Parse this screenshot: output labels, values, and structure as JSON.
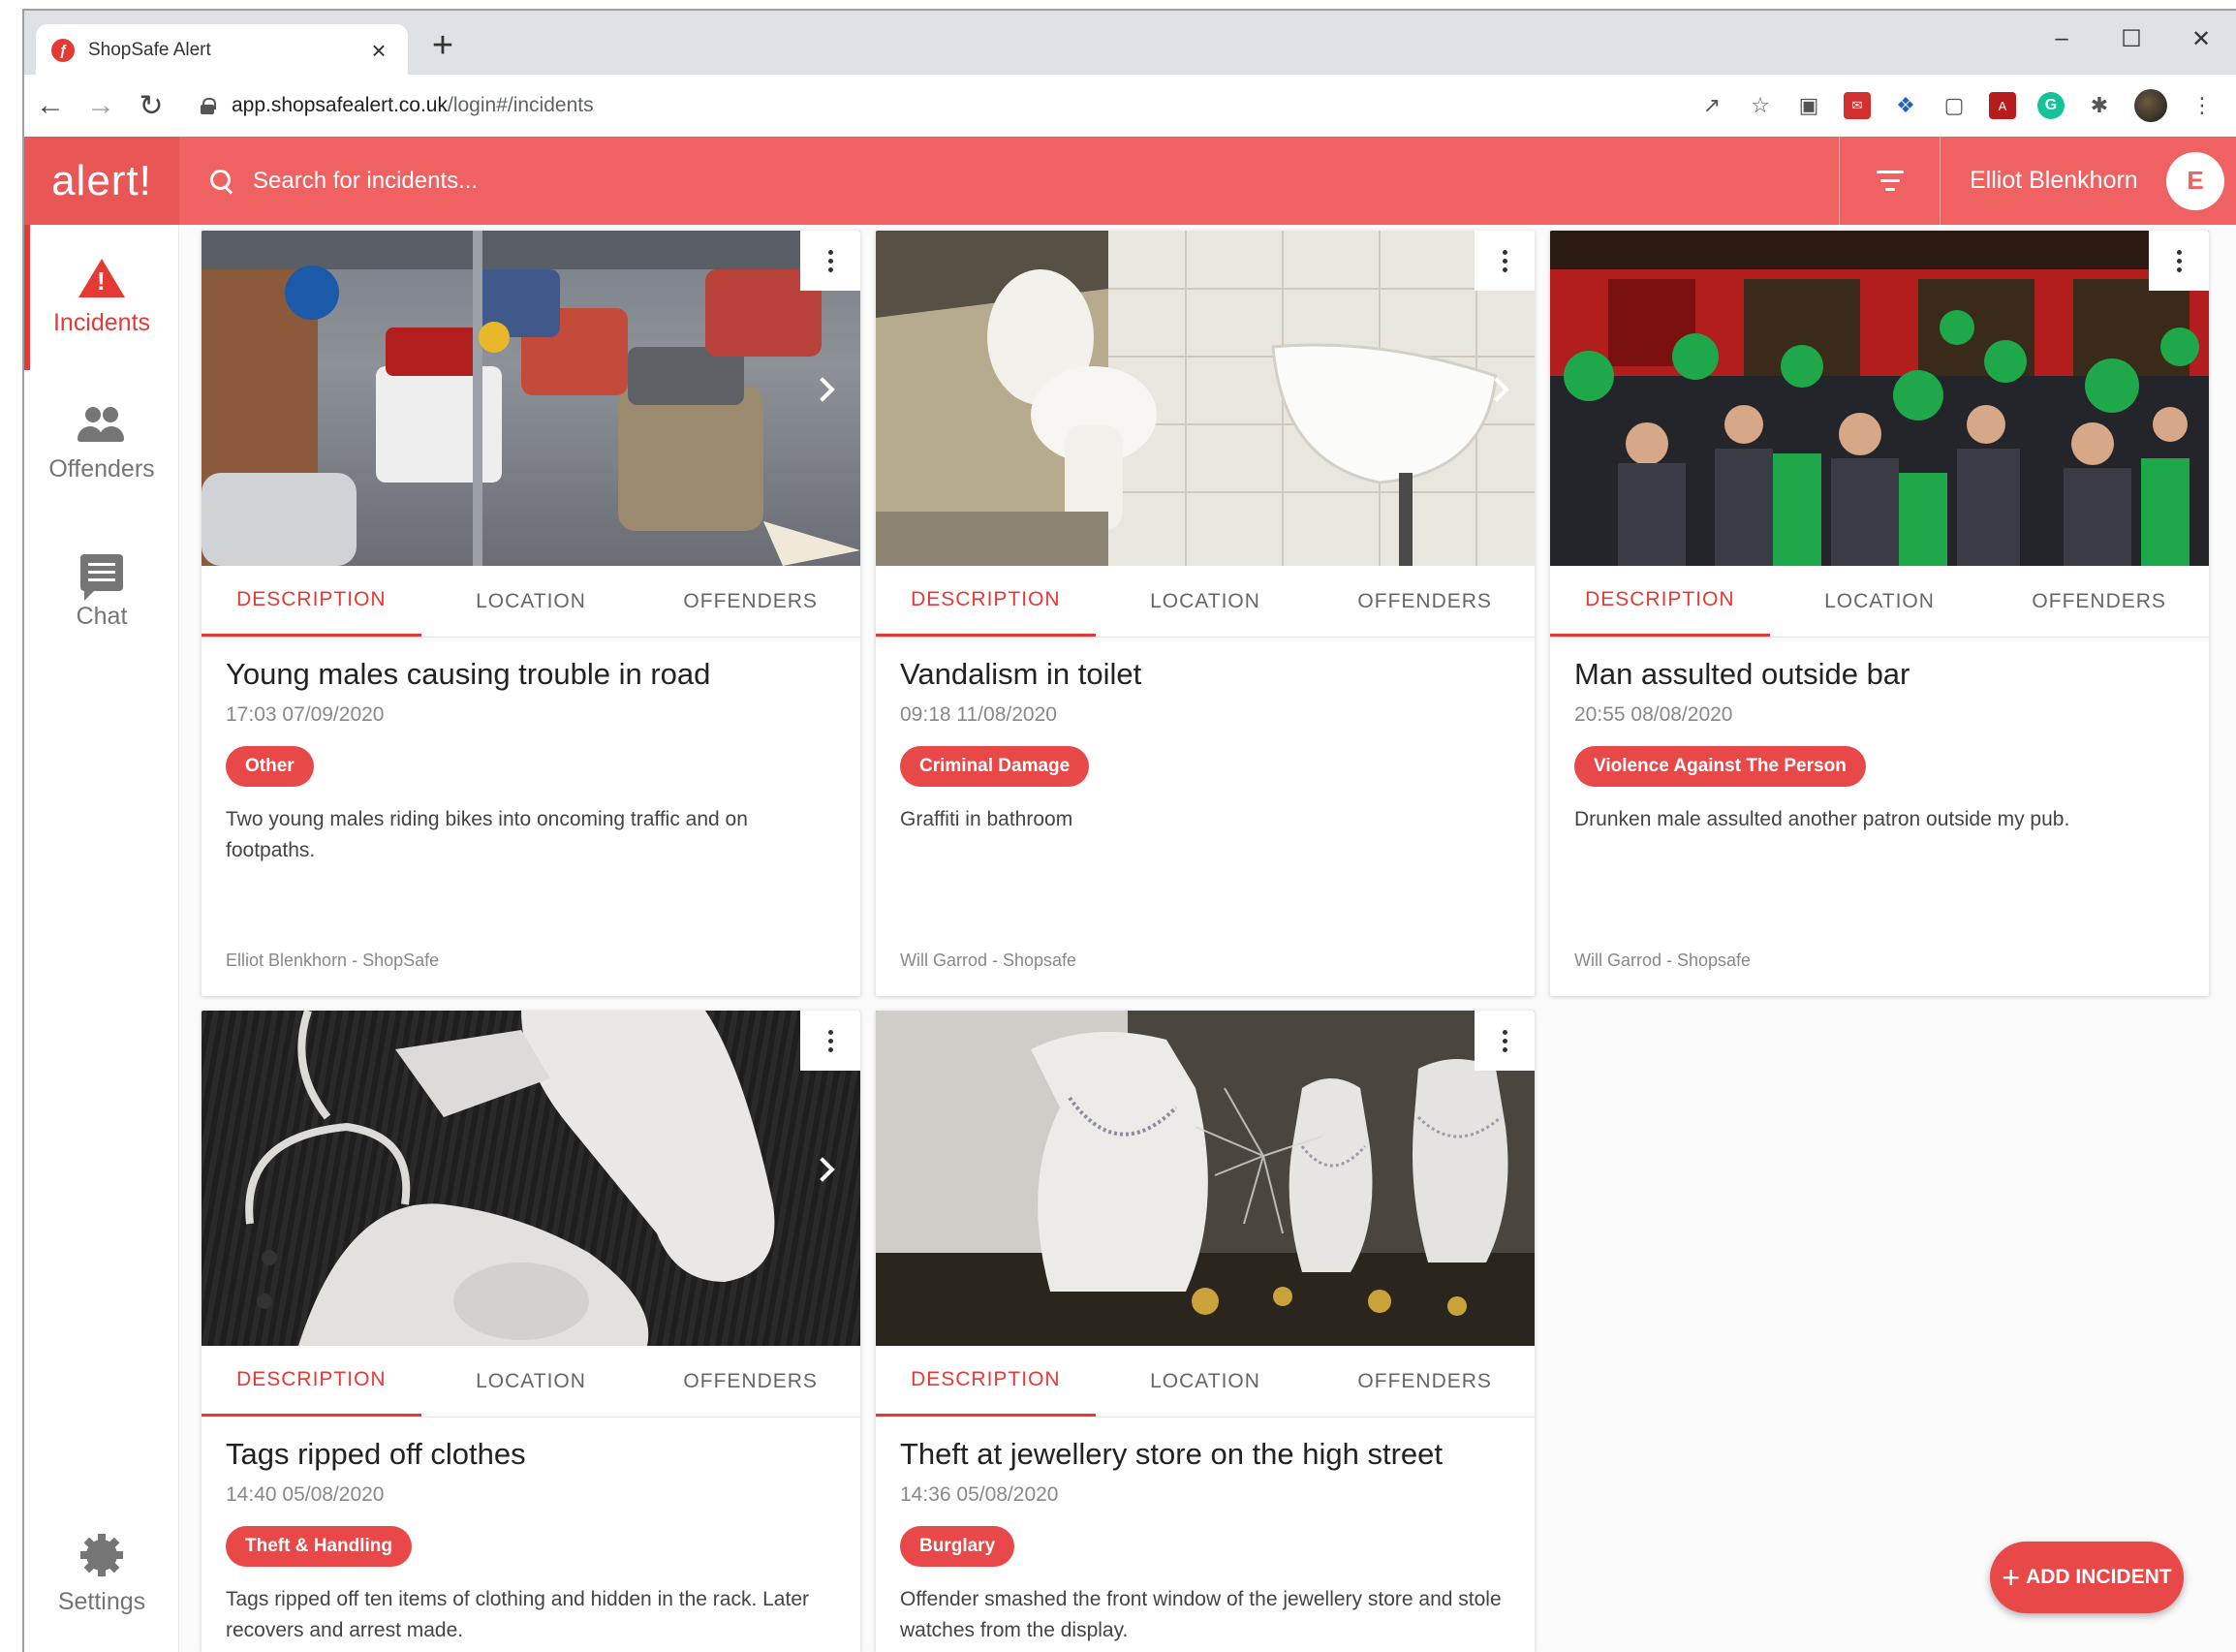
{
  "browser": {
    "tab_title": "ShopSafe Alert",
    "new_tab": "+",
    "url_host": "app.shopsafealert.co.uk",
    "url_path": "/login#/incidents"
  },
  "app": {
    "logo": "alert!",
    "search_placeholder": "Search for incidents...",
    "user_name": "Elliot Blenkhorn",
    "user_initial": "E"
  },
  "sidebar": {
    "items": [
      {
        "label": "Incidents",
        "icon": "warning-icon",
        "active": true
      },
      {
        "label": "Offenders",
        "icon": "people-icon"
      },
      {
        "label": "Chat",
        "icon": "chat-icon"
      }
    ],
    "settings_label": "Settings"
  },
  "tabs": [
    "DESCRIPTION",
    "LOCATION",
    "OFFENDERS"
  ],
  "incidents": [
    {
      "title": "Young males causing trouble in road",
      "time": "17:03  07/09/2020",
      "category": "Other",
      "description": "Two young males riding bikes into oncoming traffic and on footpaths.",
      "reporter": "Elliot Blenkhorn - ShopSafe"
    },
    {
      "title": "Vandalism in toilet",
      "time": "09:18  11/08/2020",
      "category": "Criminal Damage",
      "description": "Graffiti in bathroom",
      "reporter": "Will Garrod - Shopsafe"
    },
    {
      "title": "Man assulted outside bar",
      "time": "20:55  08/08/2020",
      "category": "Violence Against The Person",
      "description": "Drunken male assulted another patron outside my pub.",
      "reporter": "Will Garrod - Shopsafe"
    },
    {
      "title": "Tags ripped off clothes",
      "time": "14:40  05/08/2020",
      "category": "Theft & Handling",
      "description": "Tags ripped off ten items of clothing and hidden in the rack. Later recovers and arrest made.",
      "reporter": ""
    },
    {
      "title": "Theft at jewellery store on the high street",
      "time": "14:36  05/08/2020",
      "category": "Burglary",
      "description": "Offender smashed the front window of the jewellery store and stole watches from the display.",
      "reporter": ""
    }
  ],
  "fab_label": "ADD INCIDENT",
  "colors": {
    "primary": "#f06262",
    "accent": "#e53935"
  }
}
